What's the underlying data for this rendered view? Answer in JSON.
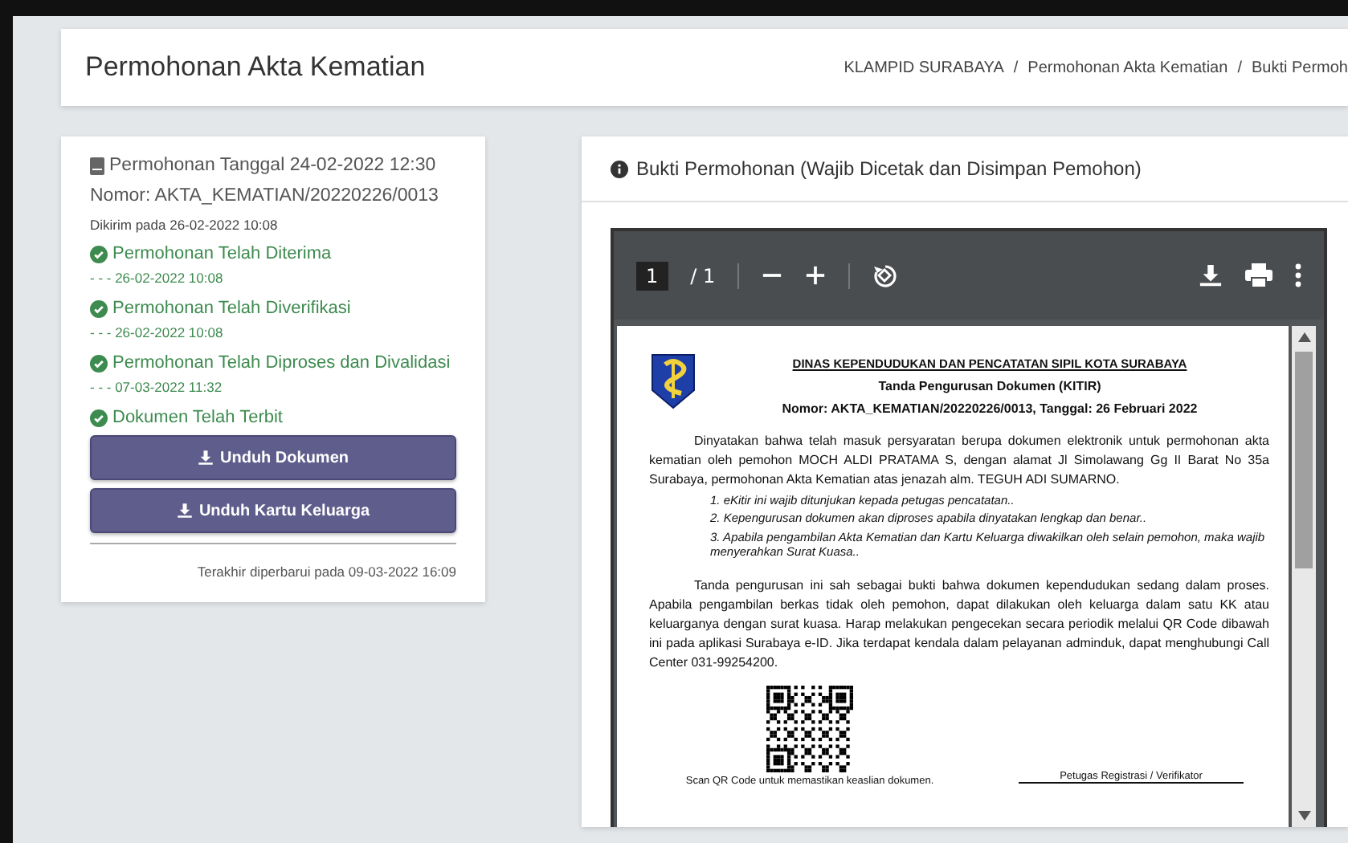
{
  "header": {
    "title": "Permohonan Akta Kematian",
    "breadcrumb": [
      "KLAMPID SURABAYA",
      "Permohonan Akta Kematian",
      "Bukti Permoh"
    ],
    "separator": "/"
  },
  "summary": {
    "date_line": "Permohonan Tanggal 24-02-2022 12:30",
    "number": "Nomor: AKTA_KEMATIAN/20220226/0013",
    "sent": "Dikirim pada 26-02-2022 10:08",
    "steps": [
      {
        "label": "Permohonan Telah Diterima",
        "time": "- - -  26-02-2022 10:08",
        "done": true
      },
      {
        "label": "Permohonan Telah Diverifikasi",
        "time": "- - -  26-02-2022 10:08",
        "done": true
      },
      {
        "label": "Permohonan Telah Diproses dan Divalidasi",
        "time": "- - -  07-03-2022 11:32",
        "done": true
      },
      {
        "label": "Dokumen Telah Terbit",
        "done": true
      }
    ],
    "buttons": [
      "Unduh Dokumen",
      "Unduh Kartu Keluarga"
    ],
    "updated": "Terakhir diperbarui pada 09-03-2022 16:09"
  },
  "proof": {
    "title": "Bukti Permohonan (Wajib Dicetak dan Disimpan Pemohon)",
    "viewer": {
      "page": "1",
      "total": "/ 1"
    },
    "document": {
      "agency": "DINAS KEPENDUDUKAN DAN PENCATATAN SIPIL KOTA SURABAYA",
      "subtitle": "Tanda Pengurusan Dokumen (KITIR)",
      "number": "Nomor: AKTA_KEMATIAN/20220226/0013, Tanggal: 26 Februari 2022",
      "intro": "Dinyatakan bahwa telah masuk persyaratan berupa dokumen elektronik untuk permohonan akta kematian oleh pemohon MOCH ALDI PRATAMA S, dengan alamat Jl Simolawang Gg II Barat No 35a Surabaya, permohonan Akta Kematian atas jenazah alm. TEGUH ADI SUMARNO.",
      "notes": [
        "1. eKitir ini wajib ditunjukan kepada petugas pencatatan..",
        "2. Kepengurusan dokumen akan diproses apabila dinyatakan lengkap dan benar..",
        "3. Apabila pengambilan Akta Kematian dan Kartu Keluarga diwakilkan oleh selain pemohon, maka wajib menyerahkan Surat Kuasa.."
      ],
      "body": "Tanda pengurusan ini sah sebagai bukti bahwa dokumen kependudukan sedang dalam proses. Apabila pengambilan berkas tidak oleh pemohon, dapat dilakukan oleh keluarga dalam satu KK atau keluarganya dengan surat kuasa. Harap melakukan pengecekan secara periodik melalui QR Code dibawah ini pada aplikasi Surabaya e-ID. Jika terdapat kendala dalam pelayanan adminduk, dapat menghubungi Call Center 031-99254200.",
      "qr_caption": "Scan QR Code untuk memastikan keaslian dokumen.",
      "signer": "Petugas Registrasi / Verifikator"
    }
  }
}
